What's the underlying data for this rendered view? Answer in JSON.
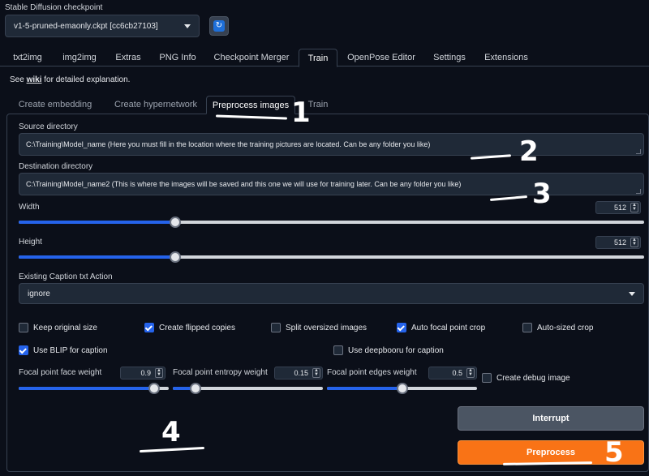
{
  "checkpoint": {
    "label": "Stable Diffusion checkpoint",
    "value": "v1-5-pruned-emaonly.ckpt [cc6cb27103]",
    "refresh_icon": "refresh-icon"
  },
  "main_tabs": [
    {
      "label": "txt2img"
    },
    {
      "label": "img2img"
    },
    {
      "label": "Extras"
    },
    {
      "label": "PNG Info"
    },
    {
      "label": "Checkpoint Merger"
    },
    {
      "label": "Train"
    },
    {
      "label": "OpenPose Editor"
    },
    {
      "label": "Settings"
    },
    {
      "label": "Extensions"
    }
  ],
  "note": {
    "prefix": "See ",
    "link": "wiki",
    "suffix": " for detailed explanation."
  },
  "sub_tabs": [
    {
      "label": "Create embedding"
    },
    {
      "label": "Create hypernetwork"
    },
    {
      "label": "Preprocess images"
    },
    {
      "label": "Train"
    }
  ],
  "source": {
    "label": "Source directory",
    "value": "C:\\Training\\Model_name  (Here you must fill in the location where the training pictures are located. Can be any folder you like)"
  },
  "destination": {
    "label": "Destination directory",
    "value": "C:\\Training\\Model_name2  (This is where the images will be saved and this one we will use for training later. Can be any folder you like)"
  },
  "width": {
    "label": "Width",
    "value": "512",
    "level": 0.25
  },
  "height": {
    "label": "Height",
    "value": "512",
    "level": 0.25
  },
  "caption_action": {
    "label": "Existing Caption txt Action",
    "value": "ignore"
  },
  "checkboxes_row1": [
    {
      "label": "Keep original size",
      "checked": false
    },
    {
      "label": "Create flipped copies",
      "checked": true
    },
    {
      "label": "Split oversized images",
      "checked": false
    },
    {
      "label": "Auto focal point crop",
      "checked": true
    },
    {
      "label": "Auto-sized crop",
      "checked": false
    }
  ],
  "checkboxes_row2": [
    {
      "label": "Use BLIP for caption",
      "checked": true
    },
    {
      "label": "Use deepbooru for caption",
      "checked": false
    }
  ],
  "focal_face": {
    "label": "Focal point face weight",
    "value": "0.9",
    "level": 0.9
  },
  "focal_entropy": {
    "label": "Focal point entropy weight",
    "value": "0.15",
    "level": 0.15
  },
  "focal_edges": {
    "label": "Focal point edges weight",
    "value": "0.5",
    "level": 0.5
  },
  "debug": {
    "label": "Create debug image",
    "checked": false
  },
  "buttons": {
    "interrupt": "Interrupt",
    "preprocess": "Preprocess"
  },
  "annotations": [
    "1",
    "2",
    "3",
    "4",
    "5"
  ],
  "colors": {
    "accent": "#2563eb",
    "primary_button": "#f97316",
    "background": "#0b0f19"
  }
}
